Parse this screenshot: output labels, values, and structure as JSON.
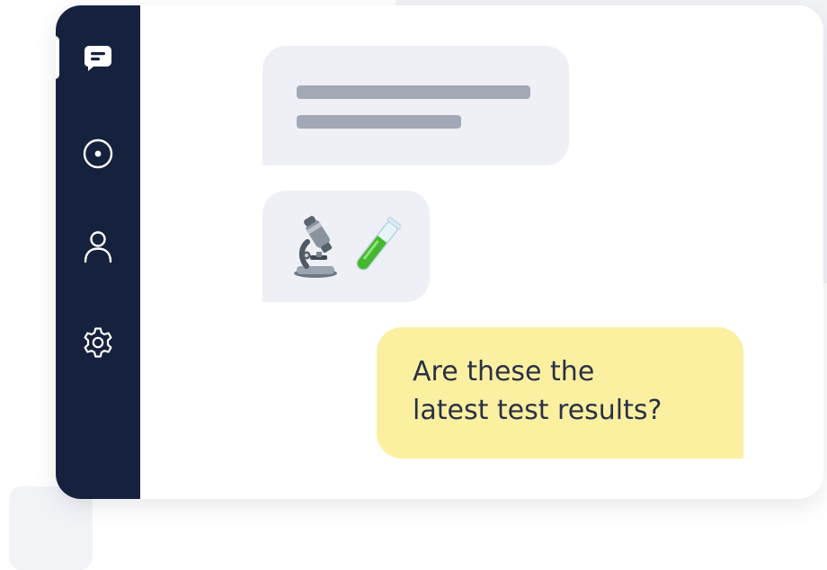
{
  "colors": {
    "sidebar_bg": "#16223d",
    "sidebar_icon": "#ffffff",
    "incoming_bubble_bg": "#eef0f5",
    "placeholder_line": "#a2a8b5",
    "outgoing_bubble_bg": "#fbf0a0",
    "outgoing_text": "#2a3047"
  },
  "sidebar": {
    "items": [
      {
        "icon": "chat-bubble-icon",
        "active": true
      },
      {
        "icon": "radio-circle-icon",
        "active": false
      },
      {
        "icon": "user-icon",
        "active": false
      },
      {
        "icon": "gear-icon",
        "active": false
      }
    ]
  },
  "messages": [
    {
      "direction": "incoming",
      "kind": "redacted-text-placeholder",
      "placeholder_lines": 2
    },
    {
      "direction": "incoming",
      "kind": "emoji",
      "emojis": [
        "microscope-icon",
        "test-tube-icon"
      ]
    },
    {
      "direction": "outgoing",
      "kind": "text",
      "text": "Are these the\nlatest test results?"
    }
  ]
}
